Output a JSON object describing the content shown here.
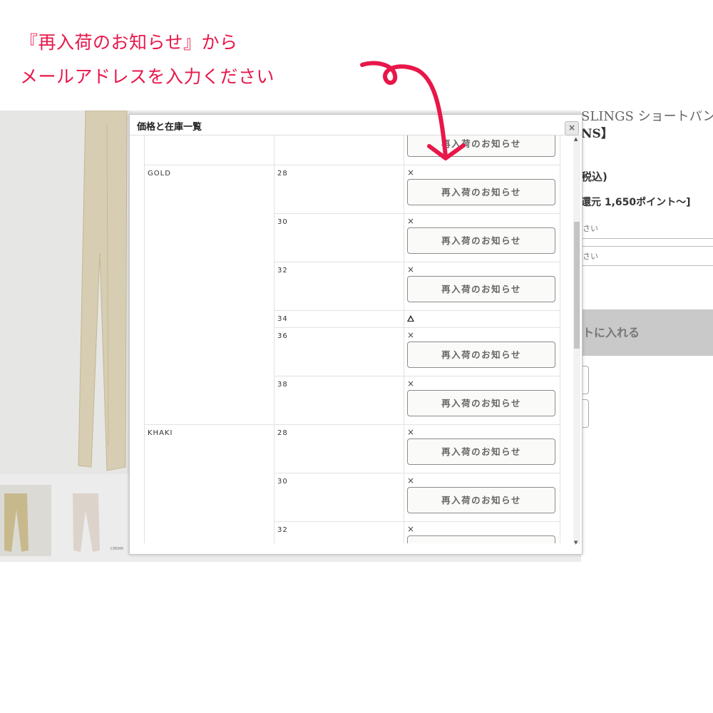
{
  "annotation": {
    "line1": "『再入荷のお知らせ』から",
    "line2": "メールアドレスを入力ください",
    "color": "#e8174a"
  },
  "background": {
    "title_fragment": "SLINGS ショートパンツ",
    "subtitle_fragment": "NS】",
    "tax_fragment": "税込)",
    "point_fragment": "還元 1,650ポイント〜]",
    "select1": "さい",
    "select2": "さい",
    "cart_fragment": "トに入れる",
    "thumb_mark": "CREAM"
  },
  "modal": {
    "title": "価格と在庫一覧",
    "close_icon": "×",
    "restock_label": "再入荷のお知らせ",
    "groups": [
      {
        "color": "GOLD",
        "rows": [
          {
            "size": "28",
            "stock": "×",
            "restock": true
          },
          {
            "size": "30",
            "stock": "×",
            "restock": true
          },
          {
            "size": "32",
            "stock": "×",
            "restock": true
          },
          {
            "size": "34",
            "stock": "△",
            "restock": false
          },
          {
            "size": "36",
            "stock": "×",
            "restock": true
          },
          {
            "size": "38",
            "stock": "×",
            "restock": true
          }
        ]
      },
      {
        "color": "KHAKI",
        "rows": [
          {
            "size": "28",
            "stock": "×",
            "restock": true
          },
          {
            "size": "30",
            "stock": "×",
            "restock": true
          },
          {
            "size": "32",
            "stock": "×",
            "restock": true
          }
        ]
      }
    ]
  }
}
